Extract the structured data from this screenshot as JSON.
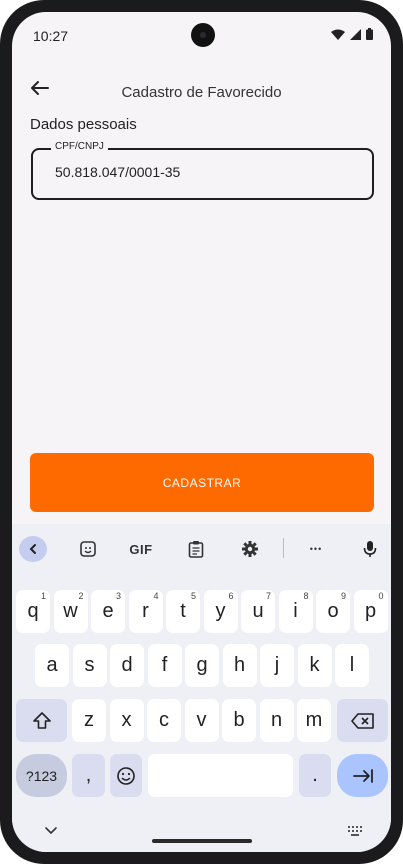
{
  "status": {
    "time": "10:27"
  },
  "header": {
    "title": "Cadastro de Favorecido"
  },
  "section_title": "Dados pessoais",
  "cpf_field": {
    "label": "CPF/CNPJ",
    "value": "50.818.047/0001-35"
  },
  "primary_button": {
    "label": "CADASTRAR"
  },
  "colors": {
    "accent": "#ff6a00",
    "enter_key": "#a9c4ff"
  },
  "keyboard": {
    "toolbar": {
      "gif_label": "GIF",
      "more_label": "•••"
    },
    "row1": [
      {
        "k": "q",
        "h": "1"
      },
      {
        "k": "w",
        "h": "2"
      },
      {
        "k": "e",
        "h": "3"
      },
      {
        "k": "r",
        "h": "4"
      },
      {
        "k": "t",
        "h": "5"
      },
      {
        "k": "y",
        "h": "6"
      },
      {
        "k": "u",
        "h": "7"
      },
      {
        "k": "i",
        "h": "8"
      },
      {
        "k": "o",
        "h": "9"
      },
      {
        "k": "p",
        "h": "0"
      }
    ],
    "row2": [
      "a",
      "s",
      "d",
      "f",
      "g",
      "h",
      "j",
      "k",
      "l"
    ],
    "row3": [
      "z",
      "x",
      "c",
      "v",
      "b",
      "n",
      "m"
    ],
    "sym_label": "?123",
    "comma": ",",
    "period": "."
  }
}
